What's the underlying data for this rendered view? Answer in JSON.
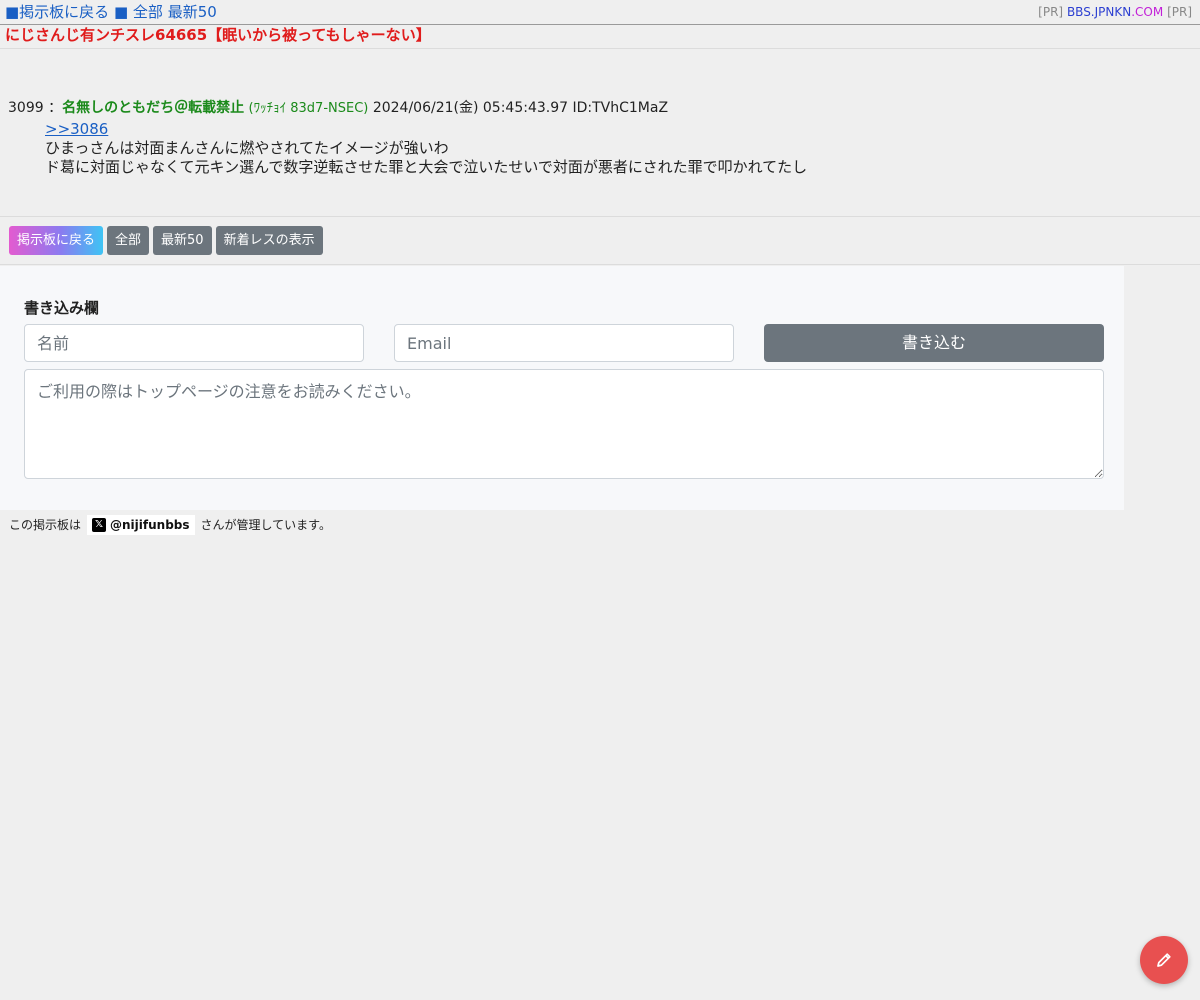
{
  "topbar": {
    "nav": {
      "back_label": "■掲示板に戻る",
      "all_label": "■ 全部",
      "latest_label": "最新50"
    },
    "pr": {
      "tag_left": "[PR]",
      "link_main": "BBS.JPNKN",
      "link_tld": ".COM",
      "tag_right": "[PR]"
    }
  },
  "thread": {
    "title": "にじさんじ有ンチスレ64665【眠いから被ってもしゃーない】"
  },
  "post": {
    "number": "3099",
    "separator": "：",
    "name": "名無しのともだち＠転載禁止",
    "trip": "(ﾜｯﾁｮｲ 83d7-NSEC)",
    "datetime": "2024/06/21(金) 05:45:43.97",
    "id": "ID:TVhC1MaZ",
    "anchor": ">>3086",
    "lines": [
      "ひまっさんは対面まんさんに燃やされてたイメージが強いわ",
      "ド葛に対面じゃなくて元キン選んで数字逆転させた罪と大会で泣いたせいで対面が悪者にされた罪で叩かれてたし"
    ]
  },
  "buttons": {
    "back": "掲示板に戻る",
    "all": "全部",
    "latest": "最新50",
    "new": "新着レスの表示"
  },
  "form": {
    "heading": "書き込み欄",
    "name_placeholder": "名前",
    "email_placeholder": "Email",
    "submit_label": "書き込む",
    "message_placeholder": "ご利用の際はトップページの注意をお読みください。"
  },
  "admin": {
    "prefix": "この掲示板は",
    "x_glyph": "𝕏",
    "handle": "@nijifunbbs",
    "suffix": "さんが管理しています。"
  },
  "fab": {
    "icon": "pencil-icon",
    "color": "#e85050"
  }
}
